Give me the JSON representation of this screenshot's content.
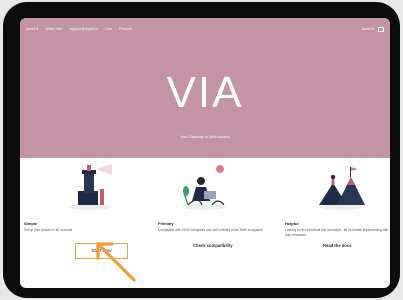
{
  "nav": {
    "left_items": [
      "About ▾",
      "White Size",
      "support@digital.io",
      "Live",
      "Promote"
    ],
    "right_item": "About ▾"
  },
  "hero": {
    "logo": "VIA",
    "tagline": "Your Gateway to Web Access"
  },
  "columns": [
    {
      "title": "Simple",
      "description": "Set up your domain in 60 seconds",
      "link": ""
    },
    {
      "title": "Friendly",
      "description": "Compatible with 1000+ templates and web builders in the SME ecosystem",
      "link": "Check compatibility"
    },
    {
      "title": "Helpful",
      "description": "Looking for the individual test and steps - let us handle implementing with 1-2 hour templates",
      "link": "Read the docs"
    }
  ],
  "cta": {
    "label": "Start now"
  },
  "colors": {
    "hero_bg": "#c294a6",
    "cta_border": "#f3a23a",
    "arrow": "#f39a3a",
    "frame": "#0c0c0c"
  }
}
